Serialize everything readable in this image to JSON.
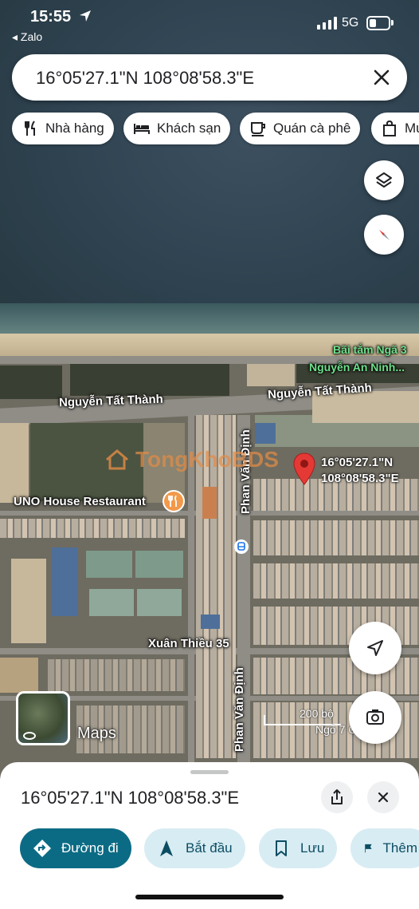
{
  "status_bar": {
    "time": "15:55",
    "back_app": "◂ Zalo",
    "network": "5G"
  },
  "search": {
    "query": "16°05'27.1\"N 108°08'58.3\"E"
  },
  "chips": [
    {
      "label": "Nhà hàng",
      "icon": "restaurant-icon"
    },
    {
      "label": "Khách sạn",
      "icon": "hotel-bed-icon"
    },
    {
      "label": "Quán cà phê",
      "icon": "coffee-cup-icon"
    },
    {
      "label": "Mu",
      "icon": "shopping-bag-icon"
    }
  ],
  "map": {
    "labels": {
      "beach_poi_line1": "Bãi tắm Ngã 3",
      "beach_poi_line2": "Nguyễn An Ninh...",
      "road_left": "Nguyễn Tất Thành",
      "road_right": "Nguyễn Tất Thành",
      "street_vertical_top": "Phan Văn Định",
      "street_vertical_bottom": "Phan Văn Định",
      "restaurant": "UNO House Restaurant",
      "xuan_thieu": "Xuân Thiều 35",
      "pin_line1": "16°05'27.1\"N",
      "pin_line2": "108°08'58.3\"E",
      "scale": "200 bộ",
      "street_peek": "Ngõ 7 Ch...em Đ",
      "maps_brand": "Maps"
    },
    "watermark": "TongKhoBDS",
    "colors": {
      "pin": "#e53935",
      "poi_green": "#6ee08a",
      "poi_orange": "#f2994a"
    }
  },
  "sheet": {
    "title": "16°05'27.1\"N 108°08'58.3\"E",
    "actions": [
      {
        "label": "Đường đi",
        "icon": "directions-icon",
        "primary": true
      },
      {
        "label": "Bắt đầu",
        "icon": "navigation-arrow-icon",
        "primary": false
      },
      {
        "label": "Lưu",
        "icon": "bookmark-icon",
        "primary": false
      },
      {
        "label": "Thêm",
        "icon": "flag-icon",
        "primary": false
      }
    ],
    "accent": "#0c6b84"
  }
}
